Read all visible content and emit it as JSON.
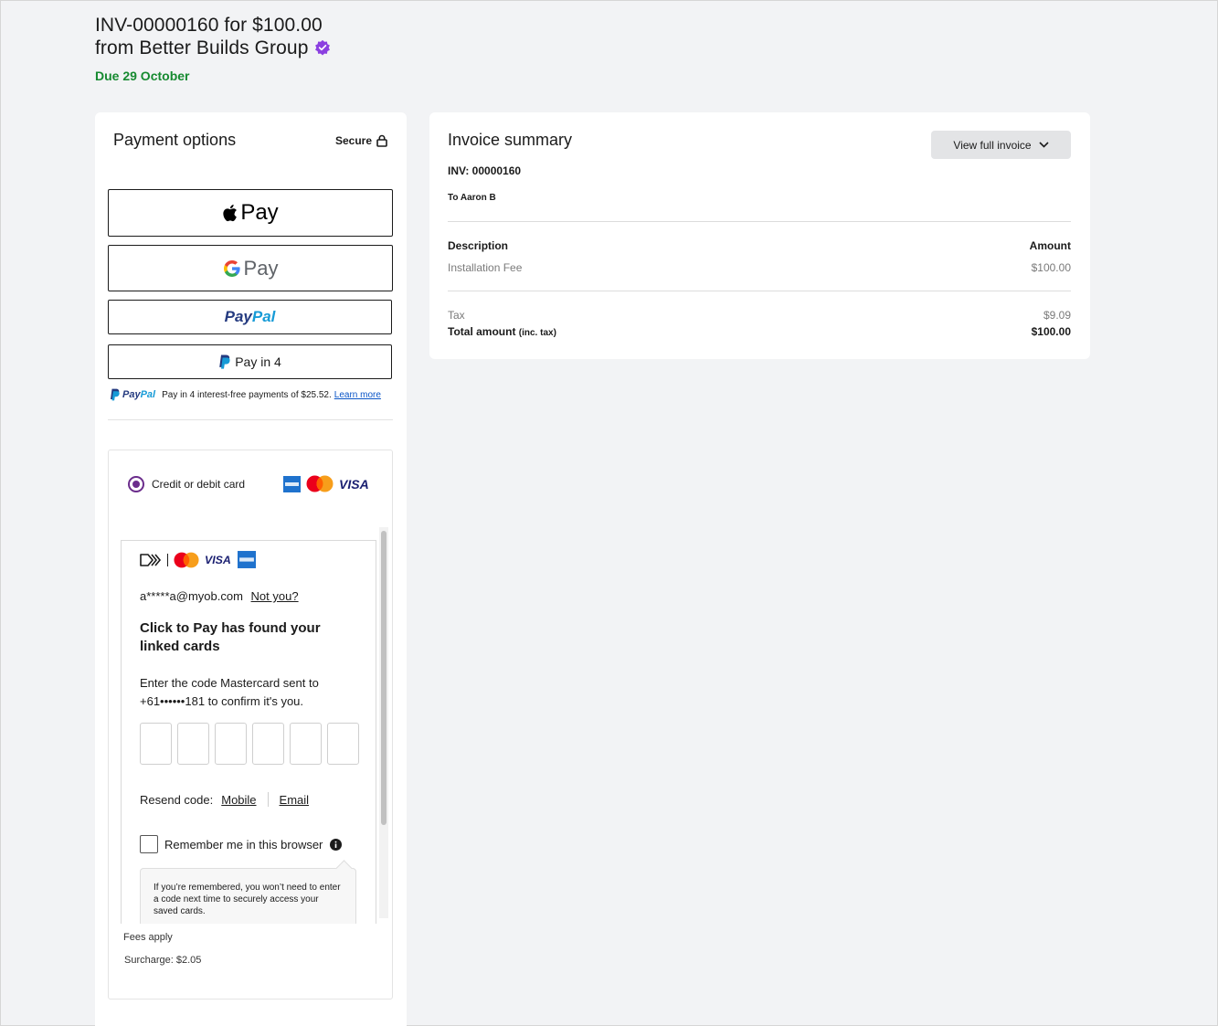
{
  "header": {
    "title_line1": "INV-00000160 for $100.00",
    "title_line2": "from Better Builds Group",
    "due": "Due 29 October"
  },
  "payment": {
    "title": "Payment options",
    "secure_label": "Secure",
    "apple_pay_label": "Pay",
    "google_pay_label": "Pay",
    "paypal_label_a": "Pay",
    "paypal_label_b": "Pal",
    "pay_in_4_label": "Pay in 4",
    "paypal_message": "Pay in 4 interest-free payments of $25.52.",
    "learn_more": "Learn more",
    "card_option_label": "Credit or debit card",
    "click_to_pay": {
      "email": "a*****a@myob.com",
      "not_you": "Not you?",
      "heading": "Click to Pay has found your linked cards",
      "description": "Enter the code Mastercard sent to +61••••••181 to confirm it's you.",
      "code_digits": 6,
      "resend_label": "Resend code:",
      "resend_mobile": "Mobile",
      "resend_email": "Email",
      "remember_label": "Remember me in this browser",
      "remember_checked": false,
      "tooltip": "If you’re remembered, you won’t need to enter a code next time to securely access your saved cards."
    },
    "fees_apply": "Fees apply",
    "surcharge": "Surcharge: $2.05"
  },
  "invoice": {
    "title": "Invoice summary",
    "view_full_invoice": "View full invoice",
    "number_label": "INV: 00000160",
    "to_label": "To Aaron B",
    "col_description": "Description",
    "col_amount": "Amount",
    "items": [
      {
        "description": "Installation Fee",
        "amount": "$100.00"
      }
    ],
    "tax_label": "Tax",
    "tax_amount": "$9.09",
    "total_label": "Total amount",
    "total_suffix": "(inc. tax)",
    "total_amount": "$100.00"
  },
  "colors": {
    "due_green": "#168a30",
    "verified_purple": "#8b3fe0",
    "radio_purple": "#6b2d8c",
    "paypal_dark": "#253b80",
    "paypal_light": "#179bd7",
    "link_blue": "#0a55c7"
  },
  "icons": {
    "verified": "verified-badge-icon",
    "lock": "lock-icon",
    "apple": "apple-logo-icon",
    "google": "google-g-icon",
    "paypal": "paypal-p-icon",
    "amex": "amex-icon",
    "mastercard": "mastercard-icon",
    "visa": "visa-icon",
    "click_to_pay": "click-to-pay-icon",
    "info": "info-icon",
    "chevron": "chevron-down-icon"
  }
}
